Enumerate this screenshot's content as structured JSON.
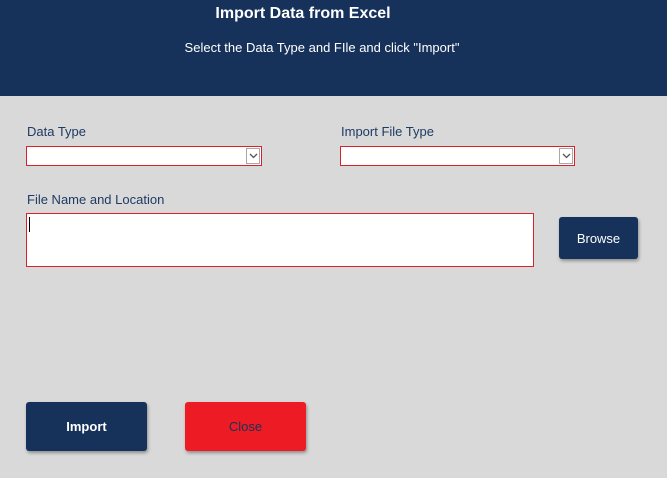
{
  "header": {
    "title": "Import Data from Excel",
    "subtitle": "Select the Data Type and FIle and click \"Import\""
  },
  "form": {
    "data_type_label": "Data Type",
    "data_type_value": "",
    "import_file_type_label": "Import File Type",
    "import_file_type_value": "",
    "file_name_label": "File Name and Location",
    "file_name_value": ""
  },
  "buttons": {
    "browse": "Browse",
    "import": "Import",
    "close": "Close"
  },
  "colors": {
    "header_bg": "#16325b",
    "body_bg": "#d9d9d9",
    "field_border": "#d6232b",
    "close_button": "#ed1c24"
  },
  "icons": {
    "dropdown": "chevron-down-icon"
  }
}
